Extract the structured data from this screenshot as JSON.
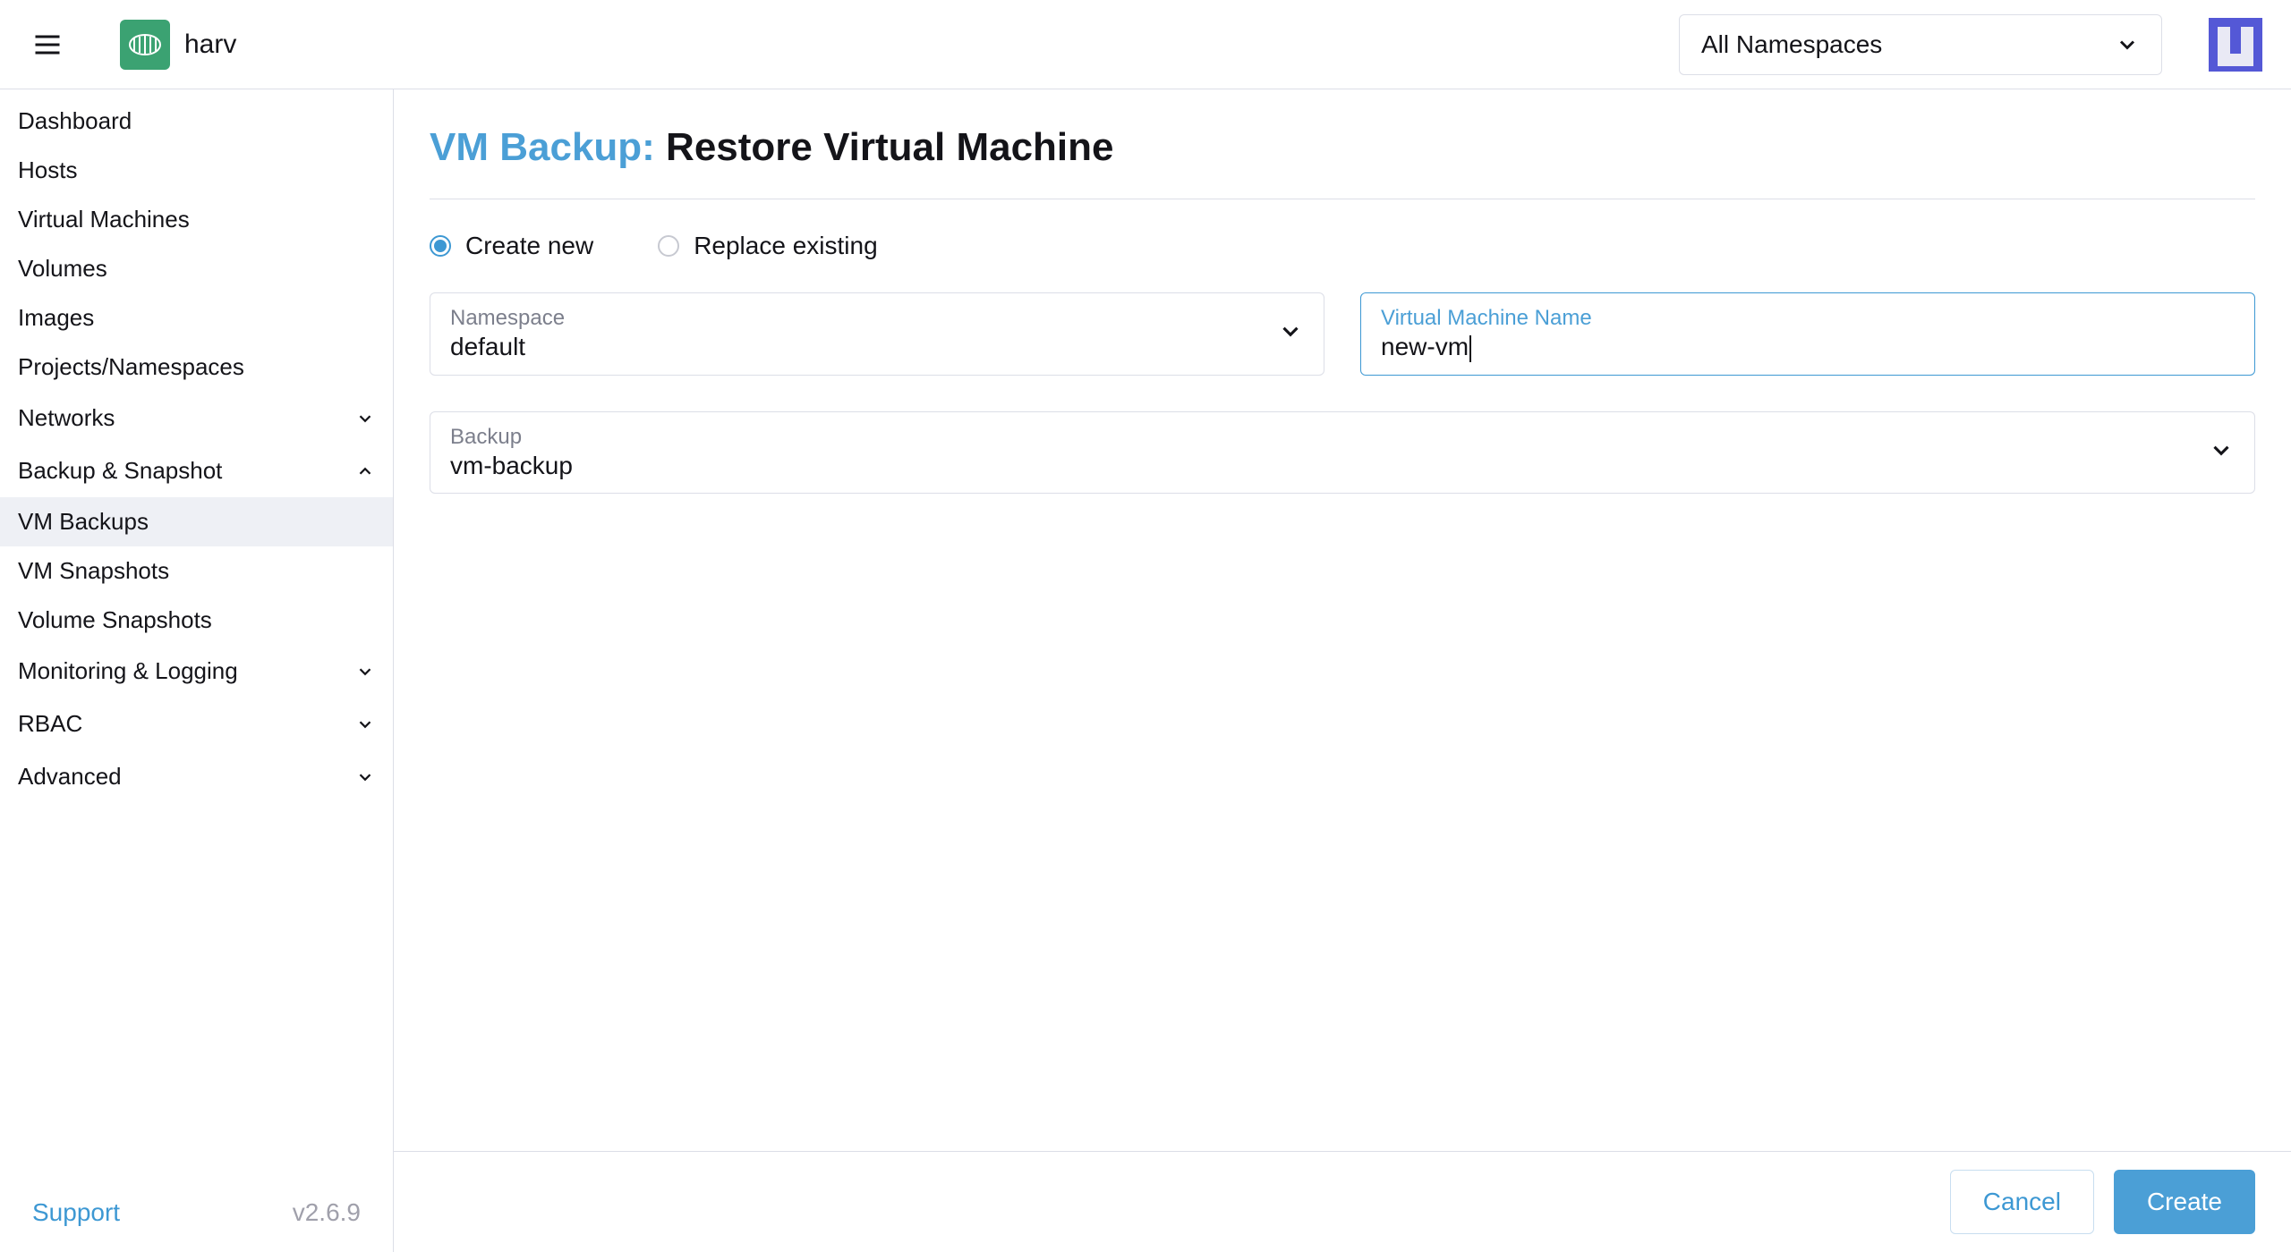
{
  "header": {
    "app_name": "harv",
    "namespace_selector": "All Namespaces"
  },
  "sidebar": {
    "items": [
      {
        "label": "Dashboard",
        "type": "item"
      },
      {
        "label": "Hosts",
        "type": "item"
      },
      {
        "label": "Virtual Machines",
        "type": "item"
      },
      {
        "label": "Volumes",
        "type": "item"
      },
      {
        "label": "Images",
        "type": "item"
      },
      {
        "label": "Projects/Namespaces",
        "type": "item"
      },
      {
        "label": "Networks",
        "type": "group",
        "expanded": false
      },
      {
        "label": "Backup & Snapshot",
        "type": "group",
        "expanded": true
      },
      {
        "label": "VM Backups",
        "type": "sub",
        "active": true
      },
      {
        "label": "VM Snapshots",
        "type": "sub"
      },
      {
        "label": "Volume Snapshots",
        "type": "sub"
      },
      {
        "label": "Monitoring & Logging",
        "type": "group",
        "expanded": false
      },
      {
        "label": "RBAC",
        "type": "group",
        "expanded": false
      },
      {
        "label": "Advanced",
        "type": "group",
        "expanded": false
      }
    ],
    "support": "Support",
    "version": "v2.6.9"
  },
  "main": {
    "title_prefix": "VM Backup: ",
    "title_main": "Restore Virtual Machine",
    "radio": {
      "create_new": "Create new",
      "replace_existing": "Replace existing"
    },
    "fields": {
      "namespace_label": "Namespace",
      "namespace_value": "default",
      "vmname_label": "Virtual Machine Name",
      "vmname_value": "new-vm",
      "backup_label": "Backup",
      "backup_value": "vm-backup"
    },
    "buttons": {
      "cancel": "Cancel",
      "create": "Create"
    }
  }
}
